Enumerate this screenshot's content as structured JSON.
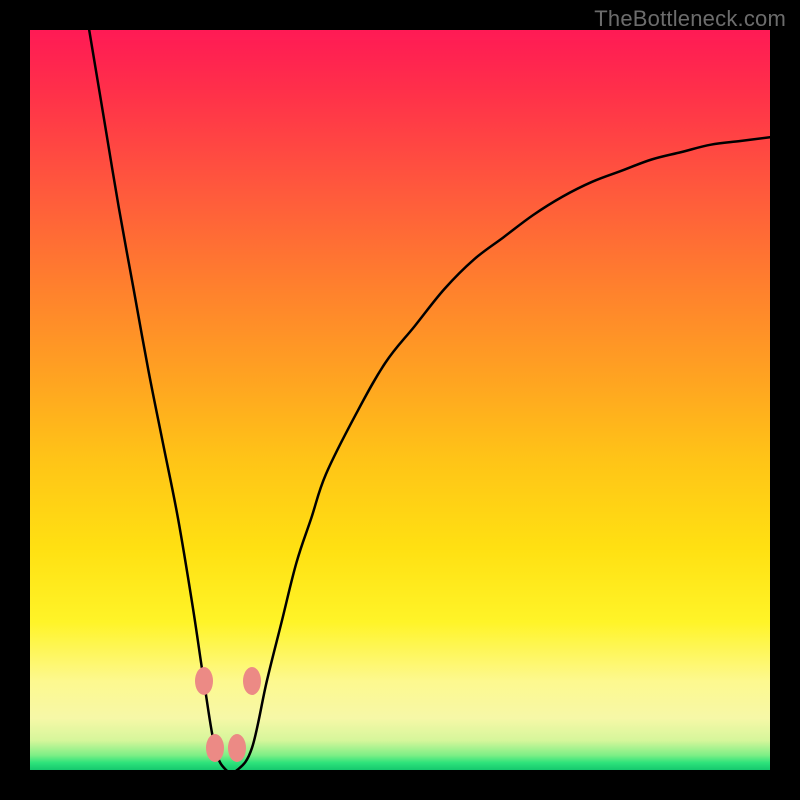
{
  "watermark": "TheBottleneck.com",
  "colors": {
    "frame": "#000000",
    "gradient_top": "#ff1a55",
    "gradient_mid": "#ffe012",
    "gradient_bottom": "#15c86e",
    "curve": "#000000",
    "marker": "#ec8a85",
    "watermark": "#6c6c6c"
  },
  "chart_data": {
    "type": "line",
    "title": "",
    "subtitle": "",
    "xlabel": "",
    "ylabel": "",
    "xlim": [
      0,
      100
    ],
    "ylim": [
      0,
      100
    ],
    "background_gradient": {
      "orientation": "vertical",
      "stops": [
        {
          "pos": 0.0,
          "color": "#ff1a55"
        },
        {
          "pos": 0.22,
          "color": "#ff5a3c"
        },
        {
          "pos": 0.47,
          "color": "#ffa321"
        },
        {
          "pos": 0.7,
          "color": "#ffe012"
        },
        {
          "pos": 0.88,
          "color": "#fdf98f"
        },
        {
          "pos": 0.98,
          "color": "#7eef86"
        },
        {
          "pos": 1.0,
          "color": "#15c86e"
        }
      ]
    },
    "series": [
      {
        "name": "bottleneck-curve",
        "color": "#000000",
        "x": [
          8,
          10,
          12,
          14,
          16,
          18,
          20,
          22,
          23.5,
          25,
          26.5,
          28,
          30,
          32,
          34,
          36,
          38,
          40,
          44,
          48,
          52,
          56,
          60,
          64,
          68,
          72,
          76,
          80,
          84,
          88,
          92,
          96,
          100
        ],
        "y": [
          100,
          88,
          76,
          65,
          54,
          44,
          34,
          22,
          12,
          3,
          0,
          0,
          3,
          12,
          20,
          28,
          34,
          40,
          48,
          55,
          60,
          65,
          69,
          72,
          75,
          77.5,
          79.5,
          81,
          82.5,
          83.5,
          84.5,
          85,
          85.5
        ]
      }
    ],
    "markers": [
      {
        "x": 23.5,
        "y": 12,
        "shape": "rounded-capsule",
        "color": "#ec8a85"
      },
      {
        "x": 25.0,
        "y": 3,
        "shape": "rounded-capsule",
        "color": "#ec8a85"
      },
      {
        "x": 28.0,
        "y": 3,
        "shape": "rounded-capsule",
        "color": "#ec8a85"
      },
      {
        "x": 30.0,
        "y": 12,
        "shape": "rounded-capsule",
        "color": "#ec8a85"
      }
    ],
    "annotations": [
      {
        "text": "TheBottleneck.com",
        "position": "top-right",
        "color": "#6c6c6c"
      }
    ]
  }
}
